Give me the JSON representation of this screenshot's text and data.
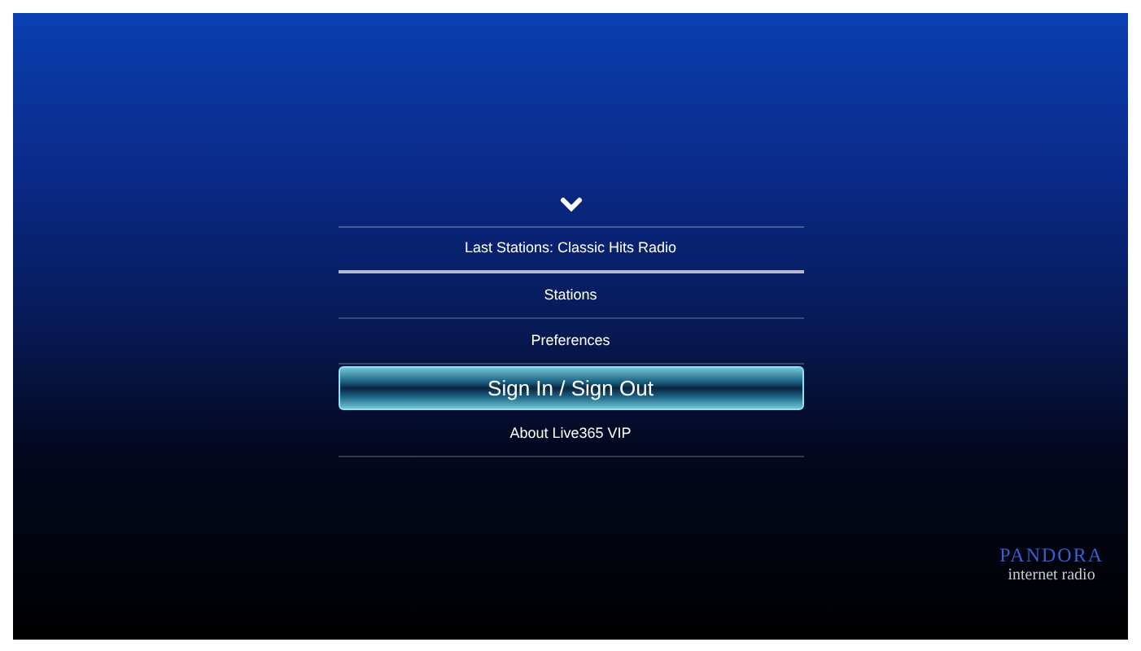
{
  "menu": {
    "items": [
      {
        "label": "Last Stations: Classic Hits Radio",
        "selected": false
      },
      {
        "label": "Stations",
        "selected": false
      },
      {
        "label": "Preferences",
        "selected": false
      },
      {
        "label": "Sign In / Sign Out",
        "selected": true
      },
      {
        "label": "About Live365 VIP",
        "selected": false
      }
    ]
  },
  "logo": {
    "name": "PANDORA",
    "tagline": "internet radio"
  }
}
